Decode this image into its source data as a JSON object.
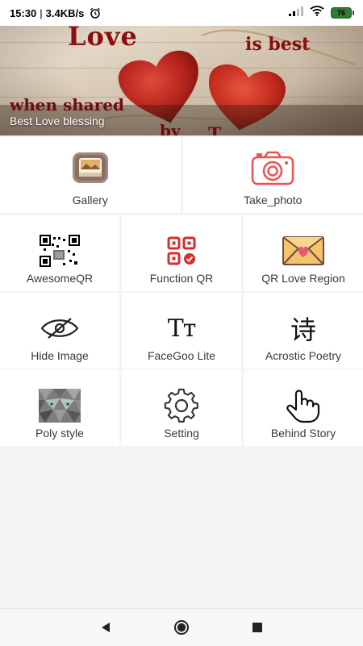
{
  "status_bar": {
    "time": "15:30",
    "speed": "3.4KB/s",
    "battery": "76",
    "icons": [
      "alarm-icon",
      "signal-icon",
      "wifi-icon",
      "battery-icon"
    ]
  },
  "banner": {
    "line_love": "Love",
    "line_best": "is best",
    "line_shared": "when shared",
    "line_by": "by",
    "line_tail": "T",
    "subtitle": "Best Love blessing"
  },
  "menu": {
    "gallery": "Gallery",
    "take_photo": "Take_photo",
    "awesome_qr": "AwesomeQR",
    "function_qr": "Function QR",
    "qr_love_region": "QR Love Region",
    "hide_image": "Hide Image",
    "facegoo_lite": "FaceGoo Lite",
    "acrostic_poetry": "Acrostic Poetry",
    "poly_style": "Poly style",
    "setting": "Setting",
    "behind_story": "Behind Story",
    "tt_glyph": "Tт",
    "poetry_glyph": "诗"
  },
  "colors": {
    "accent_red": "#d32f2f",
    "camera_pink": "#ef5350",
    "gallery_brown": "#8d6e63"
  }
}
